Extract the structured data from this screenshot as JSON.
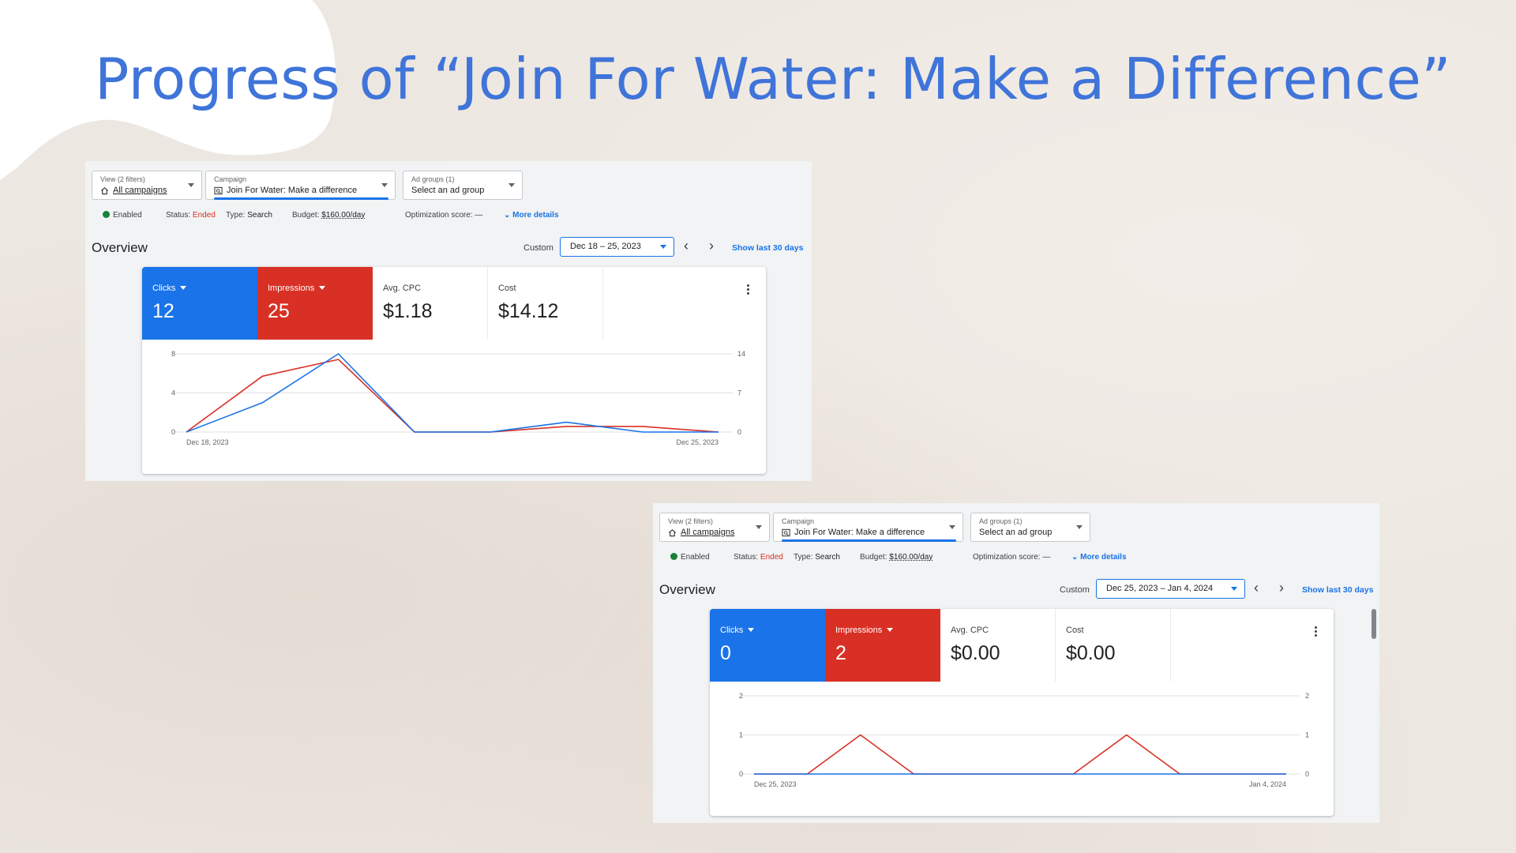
{
  "slide_title": "Progress of “Join For Water: Make a Difference”",
  "colors": {
    "title": "#3f74d9",
    "clicks": "#1a73e8",
    "impressions": "#d93025",
    "enabled": "#188038"
  },
  "shot1": {
    "view_caption": "View (2 filters)",
    "view_value": "All campaigns",
    "campaign_caption": "Campaign",
    "campaign_value": "Join For Water: Make a difference",
    "adgroup_caption": "Ad groups (1)",
    "adgroup_value": "Select an ad group",
    "enabled": "Enabled",
    "status_label": "Status:",
    "status_value": "Ended",
    "type_label": "Type:",
    "type_value": "Search",
    "budget_label": "Budget:",
    "budget_value": "$160.00/day",
    "optimization": "Optimization score: —",
    "more_details": "More details",
    "overview": "Overview",
    "custom": "Custom",
    "date_range": "Dec 18 – 25, 2023",
    "prev_icon": "‹",
    "next_icon": "›",
    "show_last": "Show last 30 days",
    "tiles": {
      "clicks_label": "Clicks",
      "clicks_value": "12",
      "impressions_label": "Impressions",
      "impressions_value": "25",
      "cpc_label": "Avg. CPC",
      "cpc_value": "$1.18",
      "cost_label": "Cost",
      "cost_value": "$14.12"
    }
  },
  "shot2": {
    "view_caption": "View (2 filters)",
    "view_value": "All campaigns",
    "campaign_caption": "Campaign",
    "campaign_value": "Join For Water: Make a difference",
    "adgroup_caption": "Ad groups (1)",
    "adgroup_value": "Select an ad group",
    "enabled": "Enabled",
    "status_label": "Status:",
    "status_value": "Ended",
    "type_label": "Type:",
    "type_value": "Search",
    "budget_label": "Budget:",
    "budget_value": "$160.00/day",
    "optimization": "Optimization score: —",
    "more_details": "More details",
    "overview": "Overview",
    "custom": "Custom",
    "date_range": "Dec 25, 2023 – Jan 4, 2024",
    "prev_icon": "‹",
    "next_icon": "›",
    "show_last": "Show last 30 days",
    "tiles": {
      "clicks_label": "Clicks",
      "clicks_value": "0",
      "impressions_label": "Impressions",
      "impressions_value": "2",
      "cpc_label": "Avg. CPC",
      "cpc_value": "$0.00",
      "cost_label": "Cost",
      "cost_value": "$0.00"
    }
  },
  "chart_data": [
    {
      "type": "line",
      "x_start_label": "Dec 18, 2023",
      "x_end_label": "Dec 25, 2023",
      "y_left_ticks": [
        "0",
        "4",
        "8"
      ],
      "y_right_ticks": [
        "0",
        "7",
        "14"
      ],
      "y_left_max": 8,
      "y_right_max": 14,
      "series": [
        {
          "name": "Clicks",
          "axis": "left",
          "values": [
            0,
            3,
            8,
            0,
            0,
            1,
            0,
            0
          ]
        },
        {
          "name": "Impressions",
          "axis": "right",
          "values": [
            0,
            10,
            13,
            0,
            0,
            1,
            1,
            0
          ]
        }
      ]
    },
    {
      "type": "line",
      "x_start_label": "Dec 25, 2023",
      "x_end_label": "Jan 4, 2024",
      "y_left_ticks": [
        "0",
        "1",
        "2"
      ],
      "y_right_ticks": [
        "0",
        "1",
        "2"
      ],
      "y_left_max": 2,
      "y_right_max": 2,
      "series": [
        {
          "name": "Clicks",
          "axis": "left",
          "values": [
            0,
            0,
            0,
            0,
            0,
            0,
            0,
            0,
            0,
            0,
            0
          ]
        },
        {
          "name": "Impressions",
          "axis": "right",
          "values": [
            0,
            0,
            1,
            0,
            0,
            0,
            0,
            1,
            0,
            0,
            0
          ]
        }
      ]
    }
  ]
}
